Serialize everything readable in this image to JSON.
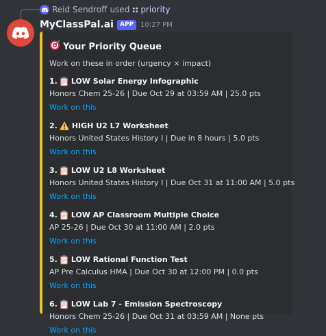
{
  "reply": {
    "user": "Reid Sendroff",
    "used_text": "used",
    "command": "priority"
  },
  "message": {
    "username": "MyClassPal.ai",
    "app_badge": "APP",
    "timestamp": "10:27 PM"
  },
  "embed": {
    "accent_color": "#f0c31c",
    "title": "Your Priority Queue",
    "title_icon": "target-icon",
    "description": "Work on these in order (urgency × impact)",
    "tasks": [
      {
        "number": "1.",
        "icon": "clipboard-icon",
        "title": "LOW Solar Energy Infographic",
        "meta": "Honors Chem 25-26 | Due Oct 29 at 03:59 AM | 25.0 pts",
        "link": "Work on this"
      },
      {
        "number": "2.",
        "icon": "warning-icon",
        "title": "HIGH U2 L7 Worksheet",
        "meta": "Honors United States History I | Due in 8 hours | 5.0 pts",
        "link": "Work on this"
      },
      {
        "number": "3.",
        "icon": "clipboard-icon",
        "title": "LOW U2 L8 Worksheet",
        "meta": "Honors United States History I | Due Oct 31 at 11:00 AM | 5.0 pts",
        "link": "Work on this"
      },
      {
        "number": "4.",
        "icon": "clipboard-icon",
        "title": "LOW AP Classroom Multiple Choice",
        "meta": "AP 25-26 | Due Oct 30 at 11:00 AM | 2.0 pts",
        "link": "Work on this"
      },
      {
        "number": "5.",
        "icon": "clipboard-icon",
        "title": "LOW Rational Function Test",
        "meta": "AP Pre Calculus HMA | Due Oct 30 at 12:00 PM | 0.0 pts",
        "link": "Work on this"
      },
      {
        "number": "6.",
        "icon": "clipboard-icon",
        "title": "LOW Lab 7 - Emission Spectroscopy",
        "meta": "Honors Chem 25-26 | Due Oct 31 at 03:59 AM | None pts",
        "link": "Work on this"
      }
    ]
  }
}
